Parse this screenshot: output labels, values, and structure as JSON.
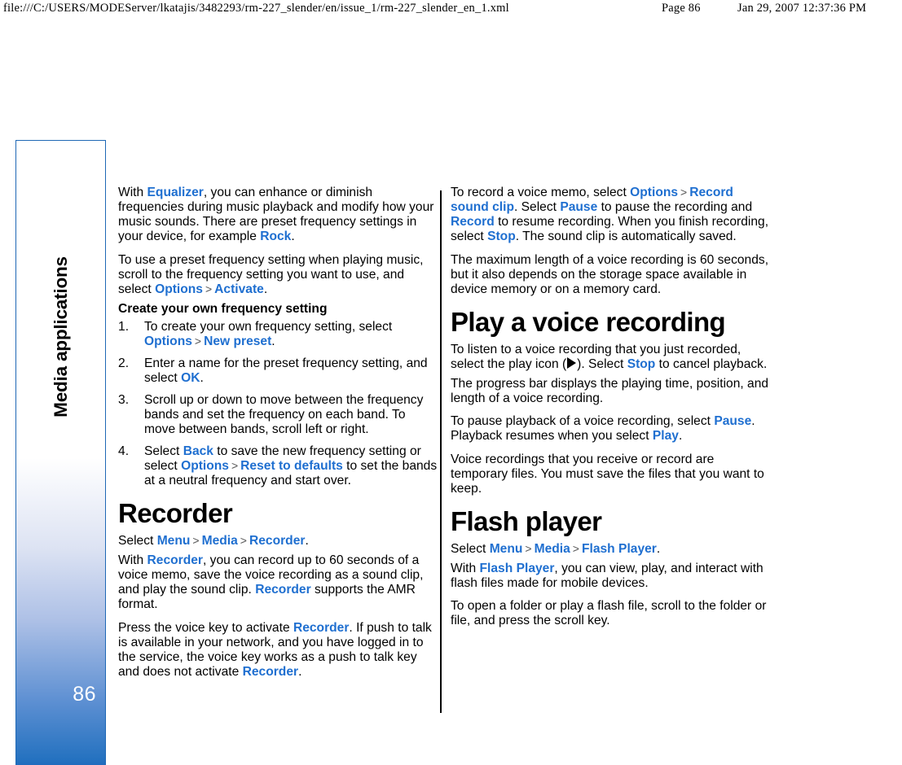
{
  "print_header": {
    "url": "file:///C:/USERS/MODEServer/lkatajis/3482293/rm-227_slender/en/issue_1/rm-227_slender_en_1.xml",
    "page_label": "Page 86",
    "timestamp": "Jan 29, 2007 12:37:36 PM"
  },
  "sidebar": {
    "chapter_title": "Media applications",
    "page_number": "86",
    "border_color": "#1f68b5",
    "gradient_end_color": "#1f6bbd"
  },
  "colors": {
    "ui_term": "#1f6fd0",
    "body_text": "#000000"
  },
  "left_column": {
    "p1": {
      "a": "With ",
      "term1": "Equalizer",
      "b": ", you can enhance or diminish frequencies during music playback and modify how your music sounds. There are preset frequency settings in your device, for example ",
      "term2": "Rock",
      "c": "."
    },
    "p2": {
      "a": "To use a preset frequency setting when playing music, scroll to the frequency setting you want to use, and select ",
      "term1": "Options",
      "sep": ">",
      "term2": "Activate",
      "b": "."
    },
    "subheading": "Create your own frequency setting",
    "steps": [
      {
        "a": "To create your own frequency setting, select ",
        "term1": "Options",
        "sep": ">",
        "term2": "New preset",
        "b": "."
      },
      {
        "a": "Enter a name for the preset frequency setting, and select ",
        "term1": "OK",
        "b": "."
      },
      {
        "a": "Scroll up or down to move between the frequency bands and set the frequency on each band. To move between bands, scroll left or right.",
        "term1": "",
        "b": ""
      },
      {
        "a": "Select ",
        "term1": "Back",
        "b": " to save the new frequency setting or select ",
        "term2": "Options",
        "sep": ">",
        "term3": "Reset to defaults",
        "c": " to set the bands at a neutral frequency and start over."
      }
    ],
    "recorder_heading": "Recorder",
    "recorder_path": {
      "a": "Select ",
      "term1": "Menu",
      "sep1": ">",
      "term2": "Media",
      "sep2": ">",
      "term3": "Recorder",
      "b": "."
    },
    "recorder_p1": {
      "a": "With ",
      "term1": "Recorder",
      "b": ", you can record up to 60 seconds of a voice memo, save the voice recording as a sound clip, and play the sound clip. ",
      "term2": "Recorder",
      "c": " supports the AMR format."
    },
    "recorder_p2": {
      "a": "Press the voice key to activate ",
      "term1": "Recorder",
      "b": ". If push to talk is available in your network, and you have logged in to the service, the voice key works as a push to talk key and does not activate ",
      "term2": "Recorder",
      "c": "."
    }
  },
  "right_column": {
    "p1": {
      "a": "To record a voice memo, select ",
      "term1": "Options",
      "sep": ">",
      "term2": "Record sound clip",
      "b": ". Select ",
      "term3": "Pause",
      "c": " to pause the recording and ",
      "term4": "Record",
      "d": " to resume recording. When you finish recording, select ",
      "term5": "Stop",
      "e": ". The sound clip is automatically saved."
    },
    "p2": "The maximum length of a voice recording is 60 seconds, but it also depends on the storage space available in device memory or on a memory card.",
    "play_heading": "Play a voice recording",
    "play_p1": {
      "a": "To listen to a voice recording that you just recorded, select the play icon (",
      "icon": "play-icon",
      "b": "). Select ",
      "term1": "Stop",
      "c": " to cancel playback."
    },
    "play_p2": "The progress bar displays the playing time, position, and length of a voice recording.",
    "play_p3": {
      "a": "To pause playback of a voice recording, select ",
      "term1": "Pause",
      "b": ". Playback resumes when you select ",
      "term2": "Play",
      "c": "."
    },
    "play_p4": "Voice recordings that you receive or record are temporary files. You must save the files that you want to keep.",
    "flash_heading": "Flash player",
    "flash_path": {
      "a": "Select ",
      "term1": "Menu",
      "sep1": ">",
      "term2": "Media",
      "sep2": ">",
      "term3": "Flash Player",
      "b": "."
    },
    "flash_p1": {
      "a": "With ",
      "term1": "Flash Player",
      "b": ", you can view, play, and interact with flash files made for mobile devices."
    },
    "flash_p2": "To open a folder or play a flash file, scroll to the folder or file, and press the scroll key."
  }
}
